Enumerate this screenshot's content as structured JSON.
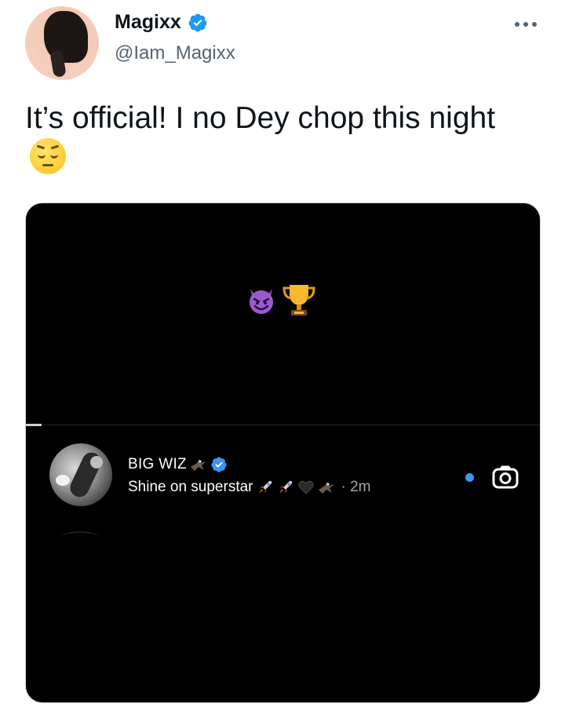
{
  "tweet": {
    "display_name": "Magixx",
    "handle": "@Iam_Magixx",
    "text": "It’s official! I no Dey chop this night",
    "text_emoji": "pensive-face"
  },
  "media": {
    "story_emojis": [
      "smiling-devil",
      "trophy"
    ],
    "comment": {
      "username": "BIG WIZ",
      "username_emoji": "eagle",
      "text": "Shine on superstar",
      "text_emojis": [
        "rocket",
        "rocket",
        "black-heart",
        "eagle"
      ],
      "time": "· 2m"
    }
  },
  "colors": {
    "verified_blue": "#1d9bf0",
    "handle_gray": "#536471",
    "media_bg": "#000000",
    "ig_blue_dot": "#3897f0"
  }
}
